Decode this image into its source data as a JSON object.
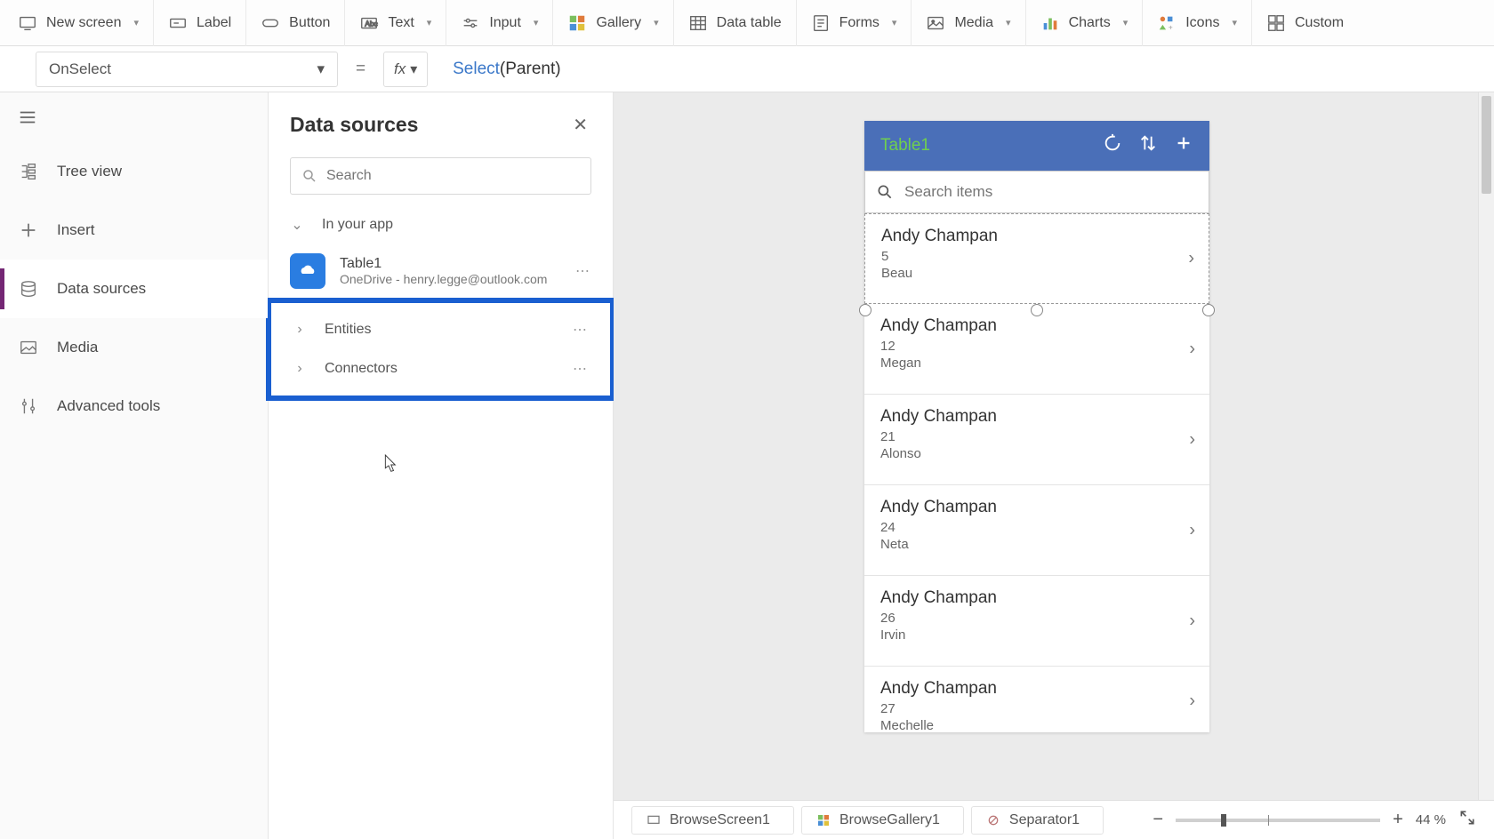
{
  "ribbon": {
    "new_screen": "New screen",
    "label": "Label",
    "button": "Button",
    "text": "Text",
    "input": "Input",
    "gallery": "Gallery",
    "data_table": "Data table",
    "forms": "Forms",
    "media": "Media",
    "charts": "Charts",
    "icons": "Icons",
    "custom": "Custom"
  },
  "formula": {
    "property": "OnSelect",
    "fn": "Select",
    "arg": "Parent"
  },
  "rail": {
    "tree_view": "Tree view",
    "insert": "Insert",
    "data_sources": "Data sources",
    "media": "Media",
    "advanced_tools": "Advanced tools"
  },
  "data_panel": {
    "title": "Data sources",
    "search_placeholder": "Search",
    "in_your_app": "In your app",
    "table_name": "Table1",
    "table_source": "OneDrive - henry.legge@outlook.com",
    "entities": "Entities",
    "connectors": "Connectors"
  },
  "phone": {
    "title": "Table1",
    "search_placeholder": "Search items",
    "items": [
      {
        "title": "Andy Champan",
        "sub1": "5",
        "sub2": "Beau"
      },
      {
        "title": "Andy Champan",
        "sub1": "12",
        "sub2": "Megan"
      },
      {
        "title": "Andy Champan",
        "sub1": "21",
        "sub2": "Alonso"
      },
      {
        "title": "Andy Champan",
        "sub1": "24",
        "sub2": "Neta"
      },
      {
        "title": "Andy Champan",
        "sub1": "26",
        "sub2": "Irvin"
      },
      {
        "title": "Andy Champan",
        "sub1": "27",
        "sub2": "Mechelle"
      }
    ]
  },
  "breadcrumbs": {
    "screen": "BrowseScreen1",
    "gallery": "BrowseGallery1",
    "separator": "Separator1"
  },
  "zoom": {
    "value": "44",
    "unit": "%"
  }
}
